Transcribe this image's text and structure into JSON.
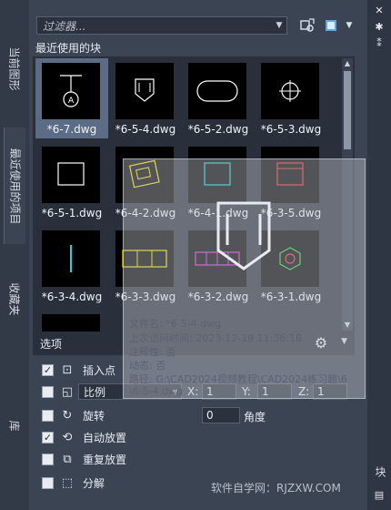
{
  "filter": {
    "placeholder": "过滤器..."
  },
  "section_title": "最近使用的块",
  "left_tabs": [
    "当前图形",
    "最近使用的项目",
    "收藏夹",
    "库"
  ],
  "right_strip": {
    "label": "块"
  },
  "thumbnails": [
    {
      "label": "*6-7.dwg",
      "selected": true
    },
    {
      "label": "*6-5-4.dwg"
    },
    {
      "label": "*6-5-2.dwg"
    },
    {
      "label": "*6-5-3.dwg"
    },
    {
      "label": "*6-5-1.dwg"
    },
    {
      "label": "*6-4-2.dwg"
    },
    {
      "label": "*6-4-1.dwg"
    },
    {
      "label": "*6-3-5.dwg"
    },
    {
      "label": "*6-3-4.dwg"
    },
    {
      "label": "*6-3-3.dwg"
    },
    {
      "label": "*6-3-2.dwg"
    },
    {
      "label": "*6-3-1.dwg"
    }
  ],
  "tooltip": {
    "file_name": "文件名: *6-5-4.dwg",
    "last_access": "上次访问时间: 2023-12-19 11:36:18",
    "annotative": "注释性: 否",
    "dynamic": "动态: 否",
    "path_line1": "路径: G:\\CAD2024视频教程\\CAD2024练习题\\6",
    "path_line2": "\\6-5-4.dwg"
  },
  "options": {
    "title": "选项",
    "insert_point": "插入点",
    "scale_select": "比例",
    "x_label": "X:",
    "x_value": "1",
    "y_label": "Y:",
    "y_value": "1",
    "z_label": "Z:",
    "z_value": "1",
    "rotate": "旋转",
    "angle_value": "0",
    "angle_label": "角度",
    "auto_place": "自动放置",
    "repeat_place": "重复放置",
    "explode": "分解"
  },
  "watermark": "软件自学网：RJZXW.COM",
  "colors": {
    "panel_bg": "#3b4453",
    "grid_bg": "#2a303b",
    "selected": "#5d6c86"
  }
}
